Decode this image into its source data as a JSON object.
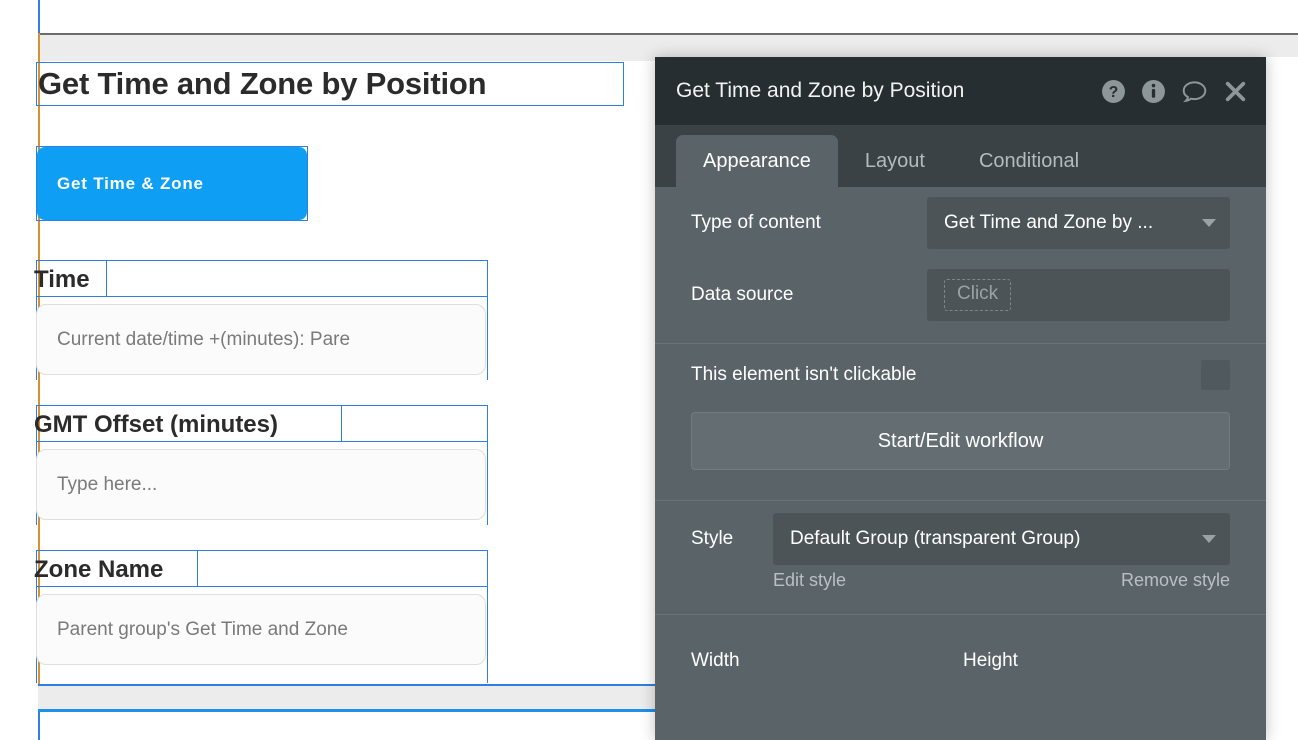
{
  "canvas": {
    "page_title": "Get Time and Zone by Position",
    "button": {
      "label": "Get Time & Zone",
      "color": "#0e9ef4"
    },
    "fields": [
      {
        "label": "Time",
        "value": "Current date/time +(minutes): Pare"
      },
      {
        "label": "GMT Offset (minutes)",
        "value": "Type here..."
      },
      {
        "label": "Zone Name",
        "value": "Parent group's Get Time and Zone"
      }
    ]
  },
  "panel": {
    "title": "Get Time and Zone by Position",
    "header_icons": [
      {
        "name": "help-icon",
        "glyph": "?"
      },
      {
        "name": "info-icon",
        "glyph": "i"
      },
      {
        "name": "comment-icon",
        "glyph": "speech-bubble"
      },
      {
        "name": "close-icon",
        "glyph": "x"
      }
    ],
    "tabs": [
      {
        "label": "Appearance",
        "active": true
      },
      {
        "label": "Layout",
        "active": false
      },
      {
        "label": "Conditional",
        "active": false
      }
    ],
    "properties": {
      "type_of_content_label": "Type of content",
      "type_of_content_value": "Get Time and Zone by ...",
      "data_source_label": "Data source",
      "data_source_value": "Click",
      "clickable_label": "This element isn't clickable",
      "workflow_button": "Start/Edit workflow",
      "style_label": "Style",
      "style_value": "Default Group (transparent Group)",
      "edit_style_link": "Edit style",
      "remove_style_link": "Remove style",
      "width_label": "Width",
      "height_label": "Height"
    },
    "colors": {
      "header_bg": "#262e31",
      "tabbar_bg": "#3a4246",
      "body_bg": "#5a6368",
      "field_bg": "#4c5458"
    }
  }
}
